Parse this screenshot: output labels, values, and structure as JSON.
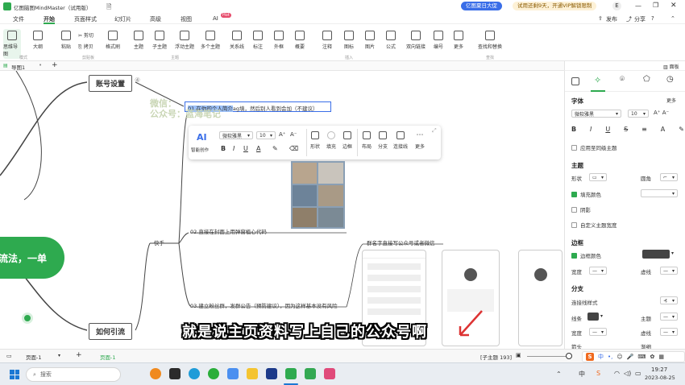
{
  "app": {
    "title": "亿图脑图MindMaster（试用版）",
    "promo_badge": "亿图夏日大促",
    "trial_notice": "试用还剩9天，开通VIP解锁限制",
    "user_initial": "E"
  },
  "menu": {
    "items": [
      "文件",
      "开始",
      "页面样式",
      "幻灯片",
      "高级",
      "视图",
      "AI"
    ],
    "active": "开始",
    "ai_badge": "Hot",
    "publish": "发布",
    "share": "分享"
  },
  "ribbon": {
    "groups": [
      {
        "name": "模式",
        "buttons": [
          "思维导图",
          "大纲"
        ]
      },
      {
        "name": "剪贴板",
        "buttons": [
          "粘贴",
          "剪切",
          "拷贝",
          "格式刷"
        ]
      },
      {
        "name": "主题",
        "buttons": [
          "主题",
          "子主题",
          "浮动主题",
          "多个主题"
        ]
      },
      {
        "name": "插入",
        "buttons": [
          "关系线",
          "标注",
          "外框",
          "概要",
          "注释",
          "图标",
          "图片",
          "公式",
          "双向链接",
          "编号",
          "更多"
        ]
      },
      {
        "name": "查找",
        "buttons": [
          "查找和替换"
        ]
      }
    ]
  },
  "doc_tab": {
    "name": "导图1",
    "add": "+"
  },
  "canvas": {
    "central_text": "流法，一单",
    "node_account": "账号设置",
    "node_account_badge": "④",
    "node_traffic": "如何引流",
    "branch_label": "快手",
    "edit_text_selected": "01.在你的个人简介",
    "edit_text_rest": "ag填，然后别人看到会加（不建议）",
    "watermark_line1": "微信：",
    "watermark_line2": "公众号：蓝海笔记",
    "item2": "02.直接在封面上用弹窗植心代码",
    "item3": "03.建立粉丝群，发群公告（预防建议），因为这样基本没有风险",
    "right_note": "群名字直接写公众号或者微信",
    "subtitle": "就是说主页资料写上自己的公众号啊"
  },
  "float_toolbar": {
    "ai": "AI",
    "ai_sub": "智能创作",
    "font": "微软雅黑",
    "size": "10",
    "bold": "B",
    "italic": "I",
    "underline": "U",
    "color": "A",
    "buttons": [
      "形状",
      "填充",
      "边框",
      "布局",
      "分支",
      "连接线",
      "更多"
    ]
  },
  "right_panel": {
    "tab_icons": [
      "page-icon",
      "sparkle-icon",
      "location-icon",
      "badge-icon",
      "clock-icon"
    ],
    "font_title": "字体",
    "more": "更多",
    "font_name": "微软雅黑",
    "font_size": "10",
    "apply_same_level": "应用至同级主题",
    "topic_title": "主题",
    "shape": "形状",
    "corner": "圆角",
    "fill_color": "填充颜色",
    "shadow": "阴影",
    "custom_width": "自定义主题宽度",
    "border_title": "边框",
    "border_color": "边框颜色",
    "width": "宽度",
    "dash": "虚线",
    "branch_title": "分支",
    "connect_style": "连接线样式",
    "line_color": "线条",
    "theme": "主题",
    "width2": "宽度",
    "dash2": "虚线",
    "arrow": "箭头",
    "taper": "渐细",
    "accent": "#2eaa4f"
  },
  "status": {
    "page_label": "页面-1",
    "active_page": "页面-1",
    "subtopic": "[子主题 193]"
  },
  "taskbar": {
    "search": "搜索",
    "time": "19:27",
    "date": "2023-08-25",
    "lang": "中"
  }
}
